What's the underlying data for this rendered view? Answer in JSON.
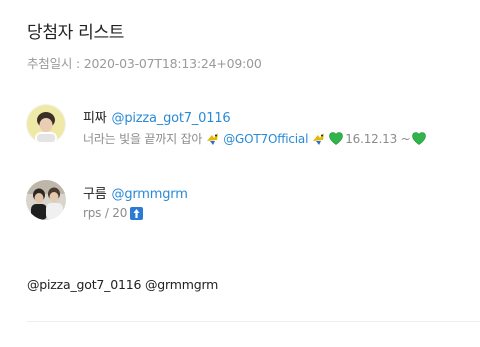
{
  "header": {
    "title": "당첨자 리스트",
    "draw_datetime": "추첨일시 : 2020-03-07T18:13:24+09:00"
  },
  "winners": [
    {
      "name": "피짜",
      "handle": "@pizza_got7_0116",
      "bio": {
        "text_before": "너라는 빛을 끝까지 잡아",
        "mention": "@GOT7Official",
        "date_text": "16.12.13 ~"
      },
      "avatar_icon": "profile-photo"
    },
    {
      "name": "구름",
      "handle": "@grmmgrm",
      "bio": {
        "text": "rps / 20"
      },
      "avatar_icon": "profile-photo"
    }
  ],
  "result_text": "@pizza_got7_0116 @grmmgrm",
  "colors": {
    "link": "#2a8ad6",
    "title": "#222222",
    "muted": "#9a9a9a",
    "heart": "#2fb54a",
    "bird": "#e6b800",
    "badge": "#2b7bd6"
  },
  "icons": {
    "bird": "bird-emoji-icon",
    "heart": "green-heart-icon",
    "badge": "up-arrow-badge-icon"
  }
}
